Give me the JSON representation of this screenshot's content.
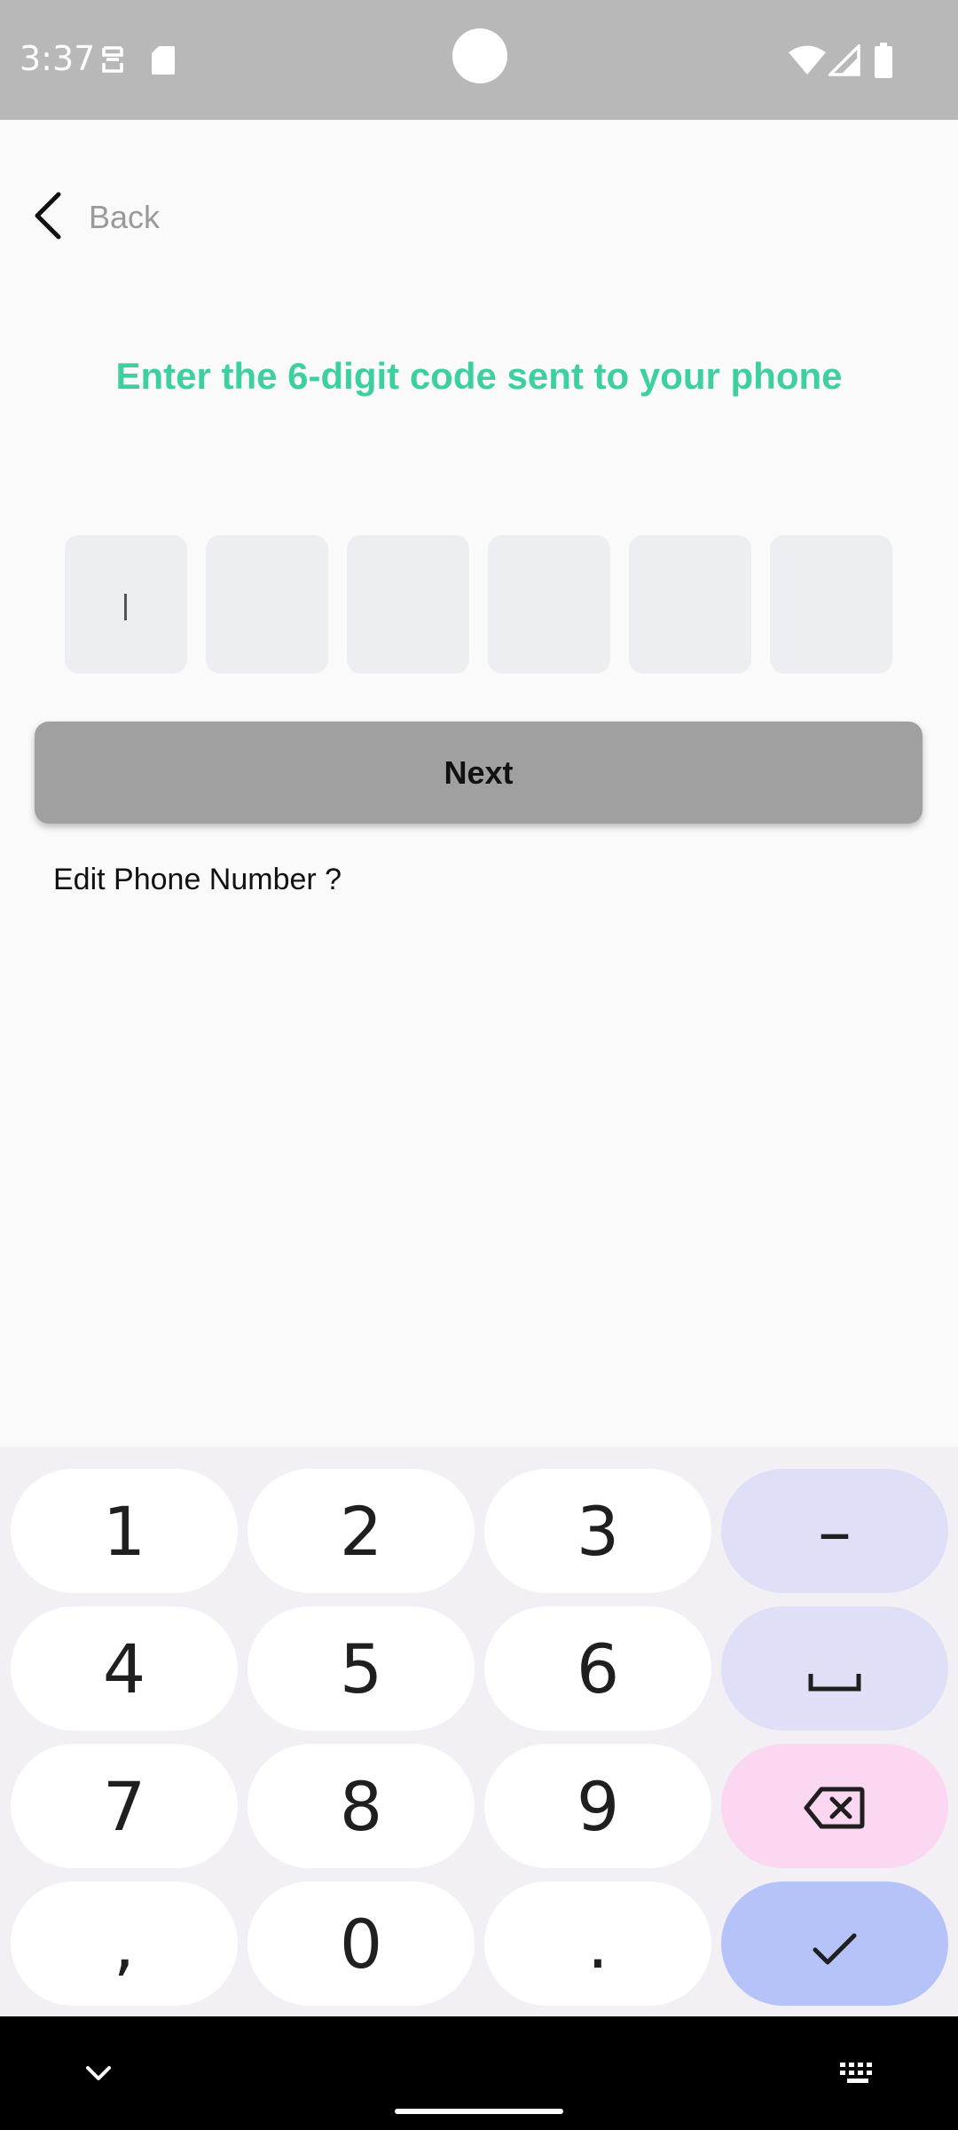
{
  "status_bar": {
    "time": "3:37",
    "icons": [
      "notification-icon",
      "sd-card-icon",
      "wifi-icon",
      "signal-icon",
      "battery-icon"
    ]
  },
  "header": {
    "back_label": "Back"
  },
  "main": {
    "title": "Enter the 6-digit code sent to your phone",
    "otp_length": 6,
    "otp_values": [
      "",
      "",
      "",
      "",
      "",
      ""
    ],
    "next_label": "Next",
    "edit_phone_label": "Edit Phone Number ?"
  },
  "keyboard": {
    "keys": [
      "1",
      "2",
      "3",
      "–",
      "4",
      "5",
      "6",
      "space",
      "7",
      "8",
      "9",
      "backspace",
      ",",
      "0",
      ".",
      "done"
    ]
  },
  "nav_bar": {
    "icons": [
      "chevron-down-icon",
      "keyboard-icon"
    ]
  },
  "colors": {
    "accent": "#3ecfa0",
    "button_disabled": "#a0a0a0",
    "otp_box": "#eceef1"
  }
}
